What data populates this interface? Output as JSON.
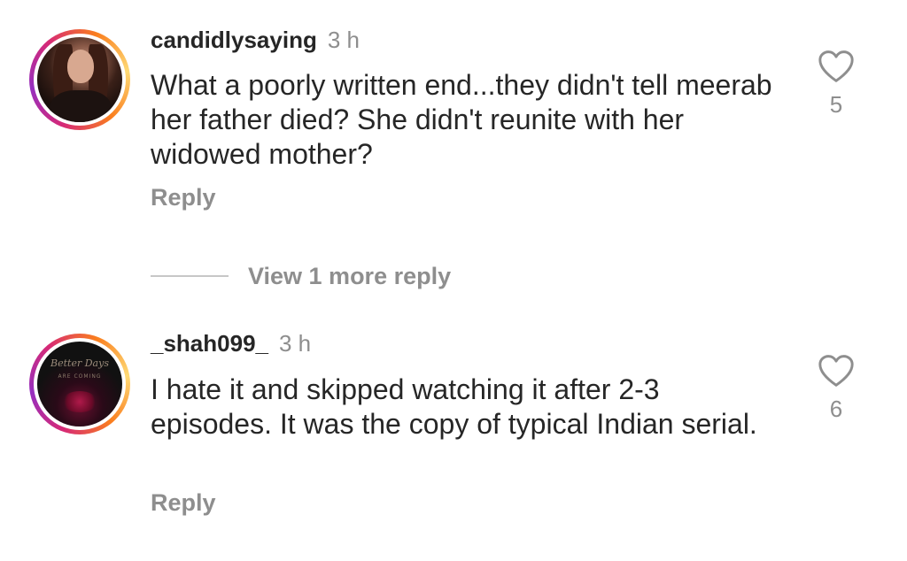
{
  "comments": [
    {
      "username": "candidlysaying",
      "time": "3 h",
      "text": "What a poorly written end...they didn't tell meerab her father died? She didn't reunite with her widowed mother?",
      "reply_label": "Reply",
      "likes": "5"
    },
    {
      "username": "_shah099_",
      "time": "3 h",
      "text": "I hate it and skipped watching it after 2-3 episodes. It was the copy of typical Indian serial.",
      "reply_label": "Reply",
      "likes": "6"
    }
  ],
  "view_more_replies": "View 1 more reply",
  "icons": {
    "like": "heart-outline-icon"
  },
  "colors": {
    "primary_text": "#262626",
    "secondary_text": "#8e8e8e",
    "story_ring_start": "#d62976",
    "story_ring_end": "#feda75"
  }
}
